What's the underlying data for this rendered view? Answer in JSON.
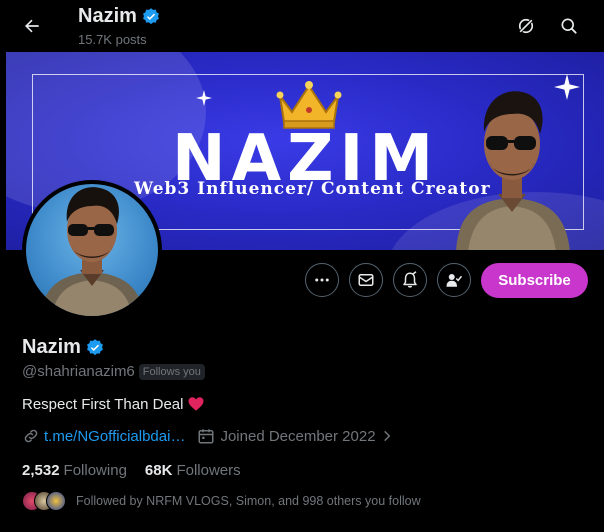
{
  "header": {
    "name": "Nazim",
    "posts_count": "15.7K posts"
  },
  "banner": {
    "title": "NAZIM",
    "subtitle": "Web3 Influencer/ Content Creator"
  },
  "actions": {
    "subscribe_label": "Subscribe"
  },
  "profile": {
    "name": "Nazim",
    "handle": "@shahrianazim6",
    "follows_you_label": "Follows you",
    "bio": "Respect First Than Deal",
    "link": "t.me/NGofficialbdai…",
    "joined": "Joined December 2022",
    "following_count": "2,532",
    "following_label": "Following",
    "followers_count": "68K",
    "followers_label": "Followers",
    "followed_by": "Followed by NRFM VLOGS, Simon, and 998 others you follow"
  },
  "colors": {
    "accent_blue": "#1d9bf0",
    "subscribe": "#c936cc",
    "banner_blue": "#2a2bc8",
    "heart": "#f91880"
  },
  "icons": [
    "back-arrow-icon",
    "verified-badge-icon",
    "grok-icon",
    "search-icon",
    "more-icon",
    "message-icon",
    "notification-bell-icon",
    "following-icon",
    "link-icon",
    "calendar-icon",
    "chevron-right-icon",
    "heart-icon"
  ]
}
